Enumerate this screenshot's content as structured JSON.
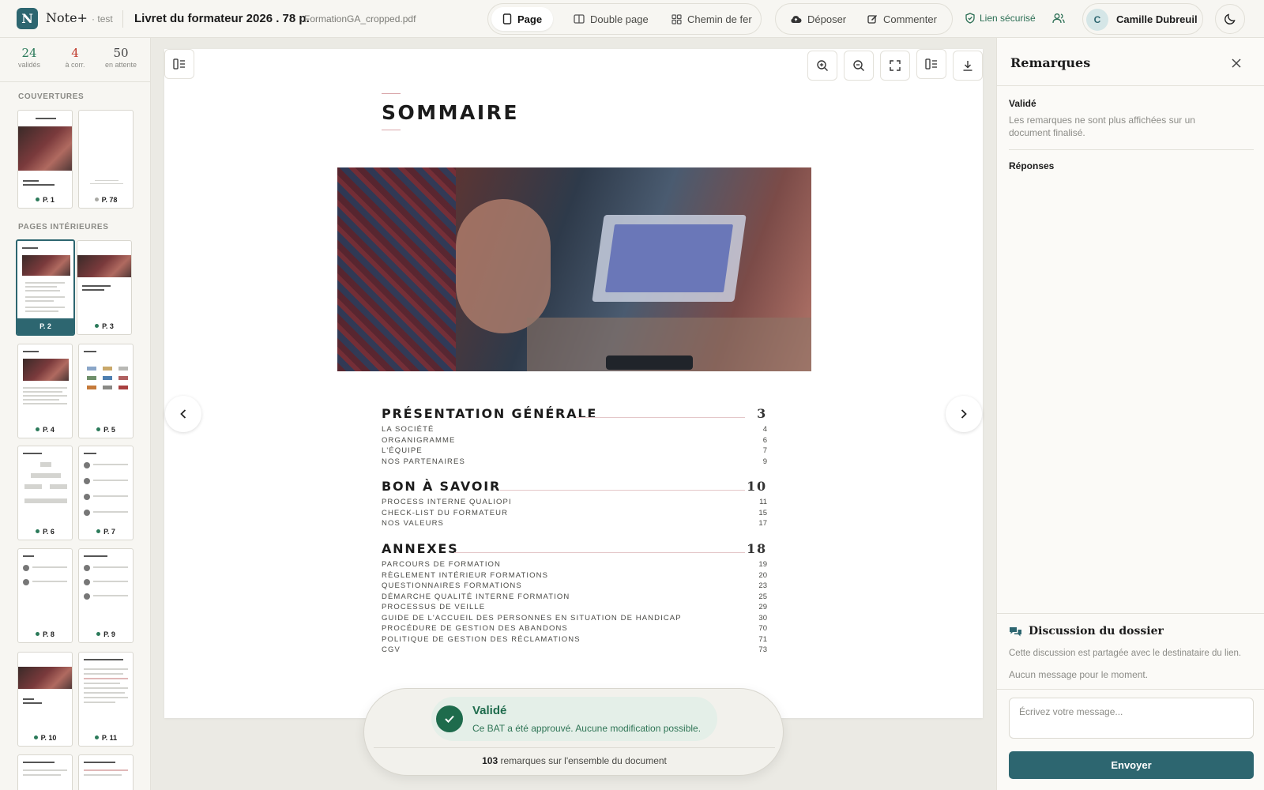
{
  "app": {
    "logo_letter": "N",
    "name": "Note+",
    "suffix": "· test"
  },
  "document": {
    "title": "Livret du formateur 2026 . 78 p.",
    "filename": "FormationGA_cropped.pdf"
  },
  "view_modes": [
    {
      "label": "Page",
      "icon": "page-icon",
      "active": true
    },
    {
      "label": "Double page",
      "icon": "double-page-icon",
      "active": false
    },
    {
      "label": "Chemin de fer",
      "icon": "grid-icon",
      "active": false
    }
  ],
  "actions": {
    "upload_label": "Déposer",
    "comment_label": "Commenter"
  },
  "secure_link": "Lien sécurisé",
  "user": {
    "initial": "C",
    "name": "Camille Dubreuil"
  },
  "stats": [
    {
      "value": "24",
      "label": "validés",
      "color": "#2b7a5a"
    },
    {
      "value": "4",
      "label": "à corr.",
      "color": "#c0392b"
    },
    {
      "value": "50",
      "label": "en attente",
      "color": "#444444"
    }
  ],
  "sidebar": {
    "covers_label": "COUVERTURES",
    "inner_label": "PAGES INTÉRIEURES",
    "covers": [
      {
        "label": "P. 1",
        "status": "validated"
      },
      {
        "label": "P. 78",
        "status": "pending"
      }
    ],
    "pages": [
      {
        "label": "P. 2",
        "active": true
      },
      {
        "label": "P. 3"
      },
      {
        "label": "P. 4"
      },
      {
        "label": "P. 5"
      },
      {
        "label": "P. 6"
      },
      {
        "label": "P. 7"
      },
      {
        "label": "P. 8"
      },
      {
        "label": "P. 9"
      },
      {
        "label": "P. 10"
      },
      {
        "label": "P. 11"
      }
    ]
  },
  "page_content": {
    "title": "SOMMAIRE",
    "sections": [
      {
        "title": "PRÉSENTATION GÉNÉRALE",
        "page": "3",
        "items": [
          {
            "label": "LA SOCIÉTÉ",
            "page": "4"
          },
          {
            "label": "ORGANIGRAMME",
            "page": "6"
          },
          {
            "label": "L'ÉQUIPE",
            "page": "7"
          },
          {
            "label": "NOS PARTENAIRES",
            "page": "9"
          }
        ]
      },
      {
        "title": "BON À SAVOIR",
        "page": "10",
        "items": [
          {
            "label": "PROCESS INTERNE QUALIOPI",
            "page": "11"
          },
          {
            "label": "CHECK-LIST DU FORMATEUR",
            "page": "15"
          },
          {
            "label": "NOS VALEURS",
            "page": "17"
          }
        ]
      },
      {
        "title": "ANNEXES",
        "page": "18",
        "items": [
          {
            "label": "PARCOURS DE FORMATION",
            "page": "19"
          },
          {
            "label": "RÈGLEMENT INTÉRIEUR FORMATIONS",
            "page": "20"
          },
          {
            "label": "QUESTIONNAIRES FORMATIONS",
            "page": "23"
          },
          {
            "label": "DÉMARCHE QUALITÉ INTERNE FORMATION",
            "page": "25"
          },
          {
            "label": "PROCESSUS DE VEILLE",
            "page": "29"
          },
          {
            "label": "GUIDE DE L'ACCUEIL DES PERSONNES EN SITUATION DE HANDICAP",
            "page": "30"
          },
          {
            "label": "PROCÉDURE DE GESTION DES ABANDONS",
            "page": "70"
          },
          {
            "label": "POLITIQUE DE GESTION DES RÉCLAMATIONS",
            "page": "71"
          },
          {
            "label": "CGV",
            "page": "73"
          }
        ]
      }
    ]
  },
  "status_toast": {
    "title": "Validé",
    "message": "Ce BAT a été approuvé. Aucune modification possible.",
    "count": "103",
    "count_suffix": "remarques sur l'ensemble du document"
  },
  "remarks_panel": {
    "title": "Remarques",
    "validated_label": "Validé",
    "validated_text": "Les remarques ne sont plus affichées sur un document finalisé.",
    "responses_label": "Réponses",
    "discussion_title": "Discussion du dossier",
    "discussion_info": "Cette discussion est partagée avec le destinataire du lien.",
    "no_messages": "Aucun message pour le moment.",
    "input_placeholder": "Écrivez votre message...",
    "send_label": "Envoyer"
  },
  "colors": {
    "accent": "#2d6670",
    "validated": "#2b7a5a",
    "to_correct": "#c0392b"
  }
}
